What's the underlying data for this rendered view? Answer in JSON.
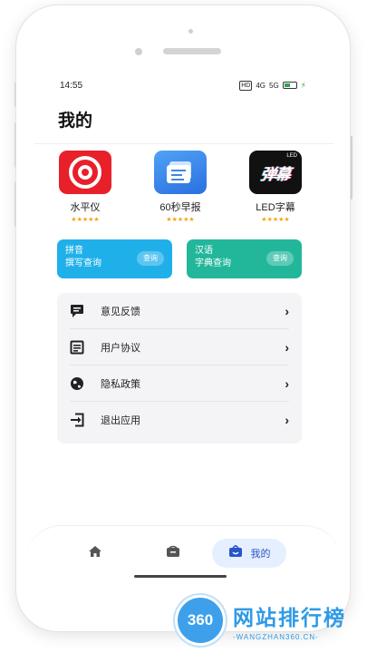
{
  "status_bar": {
    "time": "14:55",
    "network_label": "HD",
    "signal1": "4G",
    "signal2": "5G"
  },
  "page": {
    "title": "我的"
  },
  "apps": [
    {
      "name": "水平仪",
      "stars": "★★★★★",
      "icon": "level-meter-icon"
    },
    {
      "name": "60秒早报",
      "stars": "★★★★★",
      "icon": "news-card-icon"
    },
    {
      "name": "LED字幕",
      "stars": "★★★★★",
      "icon": "led-bullet-icon",
      "icon_text": "弹幕",
      "icon_tag": "LED"
    }
  ],
  "cards": [
    {
      "line1": "拼音",
      "line2": "撰写查询",
      "button": "查询",
      "color": "#1fb0ea"
    },
    {
      "line1": "汉语",
      "line2": "字典查询",
      "button": "查询",
      "color": "#22b79b"
    }
  ],
  "menu": [
    {
      "label": "意见反馈",
      "icon": "feedback-icon"
    },
    {
      "label": "用户协议",
      "icon": "agreement-icon"
    },
    {
      "label": "隐私政策",
      "icon": "globe-icon"
    },
    {
      "label": "退出应用",
      "icon": "exit-icon"
    }
  ],
  "bottom_nav": {
    "active_label": "我的",
    "accent": "#2a55c9"
  },
  "watermark": {
    "logo": "360",
    "title": "网站排行榜",
    "subtitle": "-WANGZHAN360.CN-"
  }
}
